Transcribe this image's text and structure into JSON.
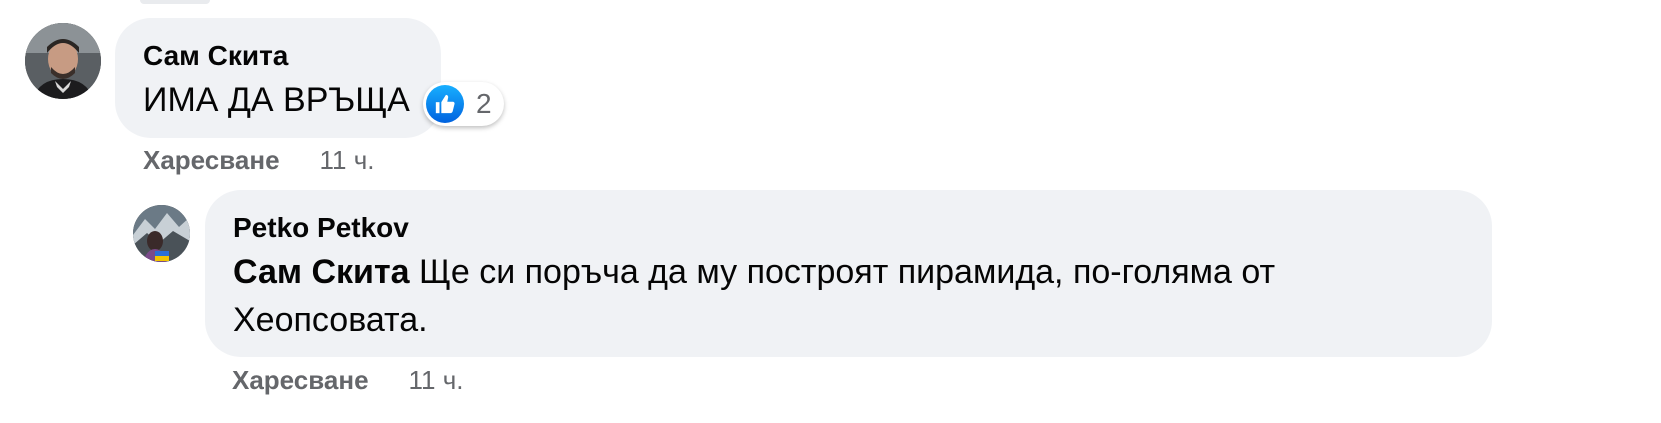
{
  "comments": [
    {
      "author": "Сам Скита",
      "text": "ИМА ДА ВРЪЩА",
      "reaction": {
        "icon": "thumbs-up-icon",
        "count": "2",
        "color": "#1877f2"
      },
      "actions": {
        "like_label": "Харесване",
        "time": "11 ч."
      }
    }
  ],
  "reply": {
    "author": "Petko Petkov",
    "mention": "Сам Скита",
    "text_line1": "Ще си поръча да му построят пирамида, по-голяма от",
    "text_line2": "Хеопсовата.",
    "actions": {
      "like_label": "Харесване",
      "time": "11 ч."
    }
  },
  "colors": {
    "bubble": "#f0f2f5",
    "secondary_text": "#65676b",
    "primary_text": "#050505"
  }
}
